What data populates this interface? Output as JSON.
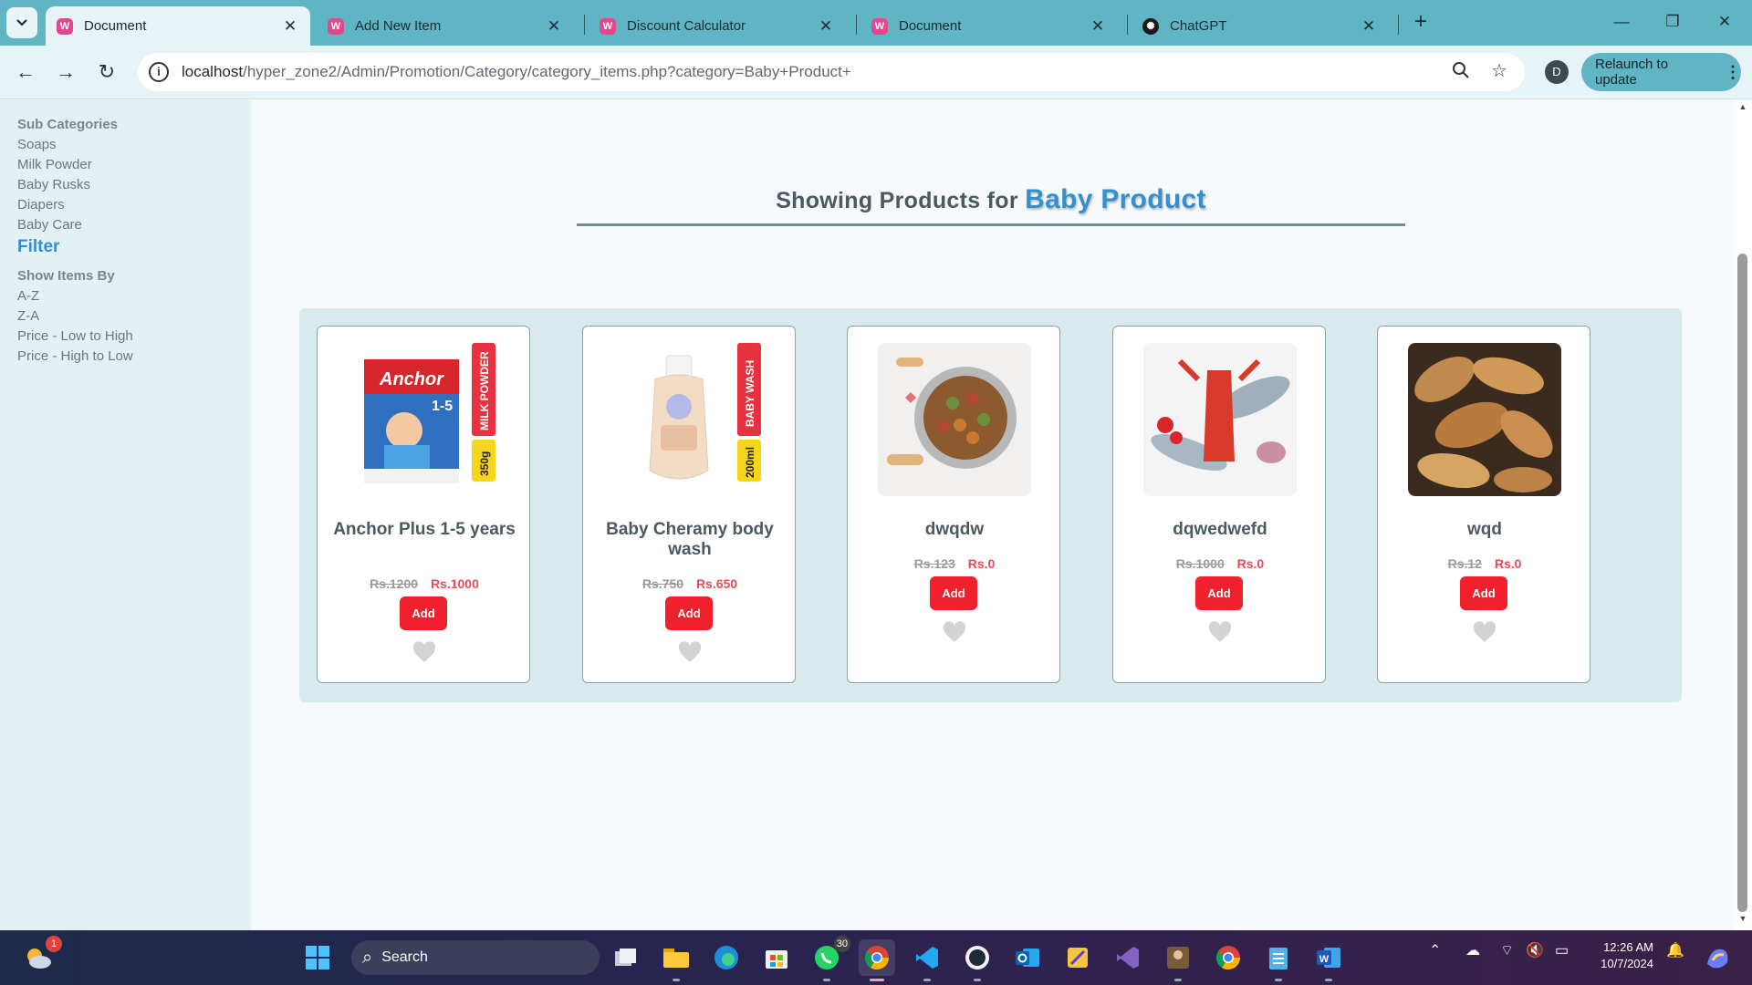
{
  "browser": {
    "tabs": [
      {
        "title": "Document",
        "active": true,
        "icon": "web-app-favicon"
      },
      {
        "title": "Add New Item",
        "active": false,
        "icon": "web-app-favicon"
      },
      {
        "title": "Discount Calculator",
        "active": false,
        "icon": "web-app-favicon"
      },
      {
        "title": "Document",
        "active": false,
        "icon": "web-app-favicon"
      },
      {
        "title": "ChatGPT",
        "active": false,
        "icon": "chatgpt-favicon"
      }
    ],
    "url_host": "localhost",
    "url_path": "/hyper_zone2/Admin/Promotion/Category/category_items.php?category=Baby+Product+",
    "profile_initial": "D",
    "relaunch_label": "Relaunch to update"
  },
  "sidebar": {
    "subcategories_heading": "Sub Categories",
    "subcategories": [
      "Soaps",
      "Milk Powder",
      "Baby Rusks",
      "Diapers",
      "Baby Care"
    ],
    "filter_title": "Filter",
    "show_by_heading": "Show Items By",
    "sort_options": [
      "A-Z",
      "Z-A",
      "Price - Low to High",
      "Price - High to Low"
    ]
  },
  "main": {
    "heading_prefix": "Showing Products for",
    "category_name": "Baby Product",
    "products": [
      {
        "name": "Anchor Plus 1-5 years",
        "old_price": "Rs.1200",
        "price": "Rs.1000",
        "add_label": "Add",
        "image": "milk-powder-box",
        "tag_top": "MILK POWDER",
        "tag_bottom": "350g"
      },
      {
        "name": "Baby Cheramy body wash",
        "old_price": "Rs.750",
        "price": "Rs.650",
        "add_label": "Add",
        "image": "body-wash-bottle",
        "tag_top": "BABY WASH",
        "tag_bottom": "200ml"
      },
      {
        "name": "dwqdw",
        "old_price": "Rs.123",
        "price": "Rs.0",
        "add_label": "Add",
        "image": "pet-food-bowl"
      },
      {
        "name": "dqwedwefd",
        "old_price": "Rs.1000",
        "price": "Rs.0",
        "add_label": "Add",
        "image": "seafood-platter"
      },
      {
        "name": "wqd",
        "old_price": "Rs.12",
        "price": "Rs.0",
        "add_label": "Add",
        "image": "bread-loaves"
      }
    ]
  },
  "taskbar": {
    "search_label": "Search",
    "weather_badge": "1",
    "whatsapp_badge": "30",
    "time": "12:26 AM",
    "date": "10/7/2024"
  },
  "colors": {
    "accent": "#3590cf",
    "add_button": "#f0202c",
    "price": "#e84a56",
    "tab_strip": "#5fb5c4"
  }
}
